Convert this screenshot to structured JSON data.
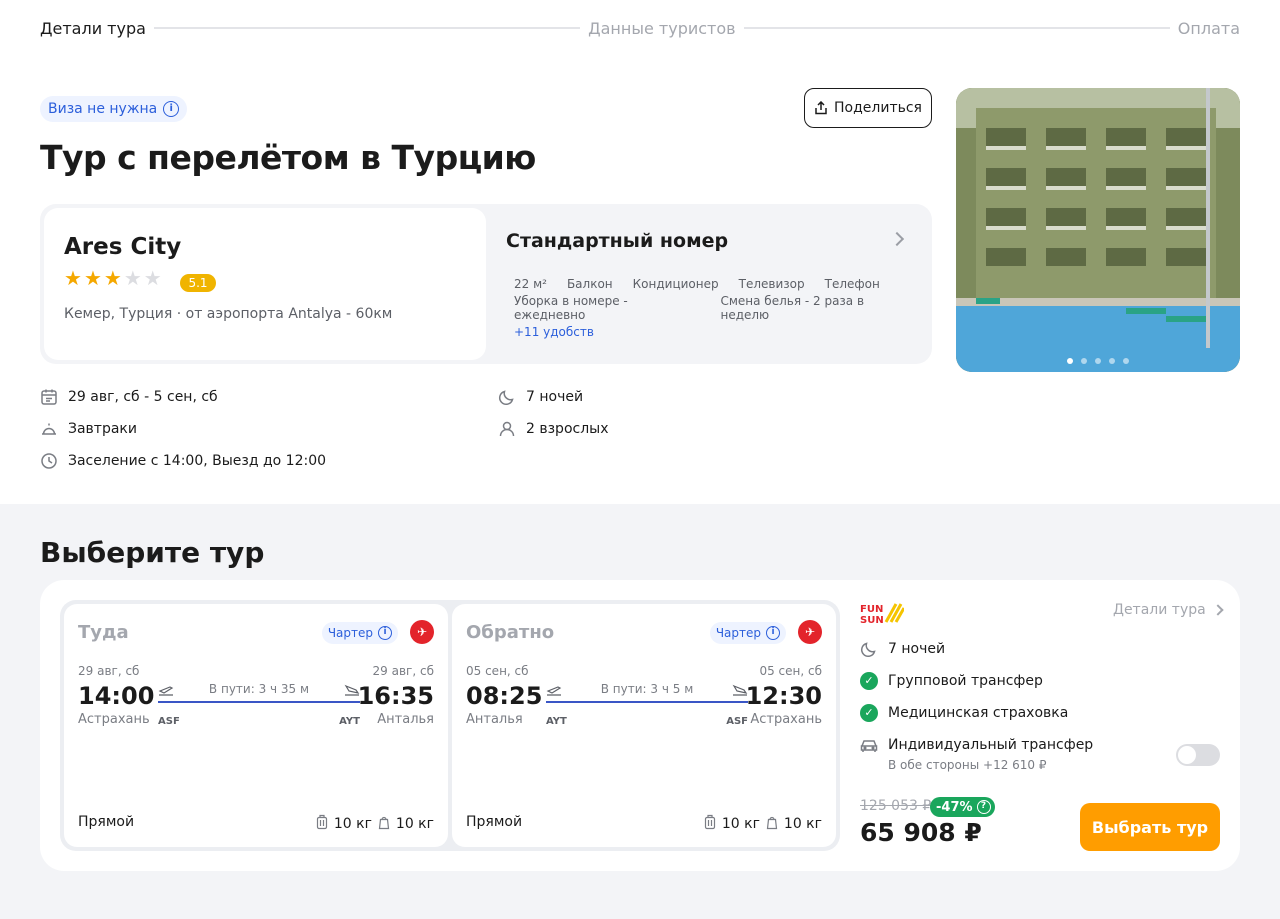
{
  "stepper": {
    "step1": "Детали тура",
    "step2": "Данные туристов",
    "step3": "Оплата"
  },
  "visa_badge": "Виза не нужна",
  "share_label": "Поделиться",
  "page_title": "Тур с перелётом в Турцию",
  "hotel": {
    "name": "Ares City",
    "stars": 3,
    "rating": "5.1",
    "location": "Кемер, Турция · от аэропорта Antalya - 60км"
  },
  "room": {
    "title": "Стандартный номер",
    "amenities_row1": [
      "22 м²",
      "Балкон",
      "Кондиционер",
      "Телевизор",
      "Телефон"
    ],
    "amenities_row2": [
      "Уборка в номере - ежедневно",
      "Смена белья - 2 раза в неделю"
    ],
    "more": "+11 удобств"
  },
  "photo": {
    "slides": 5,
    "active": 1
  },
  "facts": {
    "dates": "29 авг, сб - 5 сен, сб",
    "meal": "Завтраки",
    "checkin": "Заселение с 14:00, Выезд до 12:00",
    "nights": "7 ночей",
    "guests": "2 взрослых"
  },
  "section_title": "Выберите тур",
  "flights": [
    {
      "direction": "Туда",
      "charter": "Чартер",
      "dep_date": "29 авг, сб",
      "dep_time": "14:00",
      "dep_city": "Астрахань",
      "dep_code": "ASF",
      "duration": "В пути: 3 ч 35 м",
      "arr_date": "29 авг, сб",
      "arr_time": "16:35",
      "arr_city": "Анталья",
      "arr_code": "AYT",
      "type": "Прямой",
      "bag1": "10 кг",
      "bag2": "10 кг"
    },
    {
      "direction": "Обратно",
      "charter": "Чартер",
      "dep_date": "05 сен, сб",
      "dep_time": "08:25",
      "dep_city": "Анталья",
      "dep_code": "AYT",
      "duration": "В пути: 3 ч 5 м",
      "arr_date": "05 сен, сб",
      "arr_time": "12:30",
      "arr_city": "Астрахань",
      "arr_code": "ASF",
      "type": "Прямой",
      "bag1": "10 кг",
      "bag2": "10 кг"
    }
  ],
  "offer": {
    "operator": "FUN SUN",
    "details_link": "Детали тура",
    "nights": "7 ночей",
    "group_transfer": "Групповой трансфер",
    "insurance": "Медицинская страховка",
    "individual_transfer": "Индивидуальный трансфер",
    "individual_transfer_sub": "В обе стороны +12 610 ₽",
    "individual_transfer_enabled": false,
    "old_price": "125 053 ₽",
    "discount": "-47%",
    "price": "65 908 ₽",
    "select_label": "Выбрать тур"
  },
  "colors": {
    "accent_blue": "#2c5fdb",
    "orange": "#ff9d00",
    "green": "#1aa65c",
    "star": "#f5a800"
  }
}
